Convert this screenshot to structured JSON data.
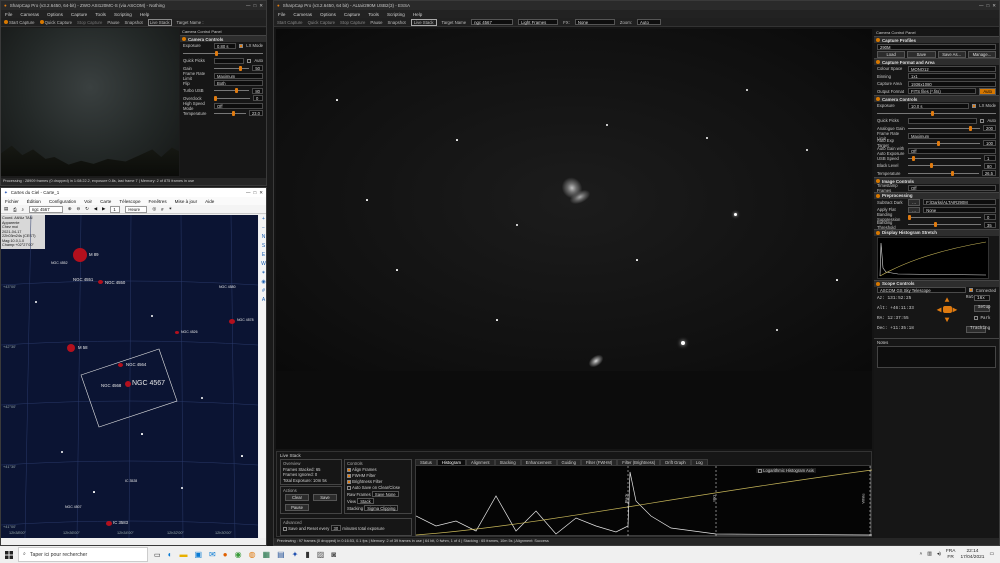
{
  "colors": {
    "accent": "#e07b10",
    "sky_bg": "#0b1433",
    "galaxy_marker": "#b3101d"
  },
  "small_sharpcap": {
    "title": "SharpCap Pro (v3.2.6450, 64-bit) - ZWO ASI120MC-S (via ASCOM) - Nothing",
    "menu": [
      "File",
      "Cameras",
      "Options",
      "Capture",
      "Tools",
      "Scripting",
      "Help"
    ],
    "toolbar": {
      "start": "Start Capture",
      "quick": "Quick Capture",
      "stop": "Stop Capture",
      "pause": "Pause",
      "snapshot": "Snapshot",
      "live_stack": "Live Stack",
      "target_label": "Target Name :"
    },
    "status": "Processing : 28909 frames (0 dropped) in 1:08:22.2, exposure 0.8s, last frame 7 | Memory: 2 of 875 frames in use",
    "controls": {
      "header": "Camera Controls",
      "panel_title": "Camera Control Panel",
      "exposure_label": "Exposure",
      "exposure_value": "0.80 s",
      "lx_mode": "LX Mode",
      "quick_picks": "Quick Picks",
      "auto": "Auto",
      "gain_label": "Gain",
      "gain_value": "50",
      "frame_rate_label": "Frame Rate Limit",
      "frame_rate_value": "Maximum",
      "flip_label": "Flip",
      "flip_value": "Both",
      "turbo_label": "Turbo USB",
      "turbo_value": "80",
      "overclock_label": "Overclock",
      "overclock_value": "0",
      "highspeed_label": "High Speed Mode",
      "highspeed_value": "Off",
      "temp_label": "Temperature",
      "temp_value": "23.0"
    }
  },
  "cdc": {
    "title": "Cartes du Ciel - Carte_1",
    "menu": [
      "Fichier",
      "Édition",
      "Configuration",
      "Voir",
      "Carte",
      "Télescope",
      "Fenêtres",
      "Mise à jour",
      "Aide"
    ],
    "search": "ngc 4567",
    "zoom_value": "1",
    "zoom_unit": "Heure",
    "info": [
      "Coord. Alt/Az TAN",
      "Apparente",
      "Chez moi",
      "2021-04-17",
      "22h03m24s (CEST)",
      "Mag:10.0,1.0",
      "Champ:+02°27'00\""
    ],
    "objects": [
      {
        "name": "M 89",
        "size": 14
      },
      {
        "name": "M 58",
        "size": 8
      },
      {
        "name": "NGC 4567",
        "size": 6
      },
      {
        "name": "NGC 4568",
        "size": 0
      },
      {
        "name": "NGC 4564",
        "size": 5
      },
      {
        "name": "NGC 4550",
        "size": 5
      },
      {
        "name": "NGC 4551",
        "size": 0
      },
      {
        "name": "NGC 4552",
        "size": 0
      },
      {
        "name": "NGC 4526",
        "size": 4
      },
      {
        "name": "NGC 4578",
        "size": 6
      },
      {
        "name": "NGC 4580",
        "size": 0
      },
      {
        "name": "IC 3528",
        "size": 0
      },
      {
        "name": "IC 3583",
        "size": 0
      },
      {
        "name": "NGC 4507",
        "size": 0
      }
    ],
    "dec_ticks": [
      "+43°00'",
      "+42°30'",
      "+42°00'",
      "+41°30'",
      "+41°00'"
    ],
    "ra_ticks": [
      "12h38'00\"",
      "12h36'00\"",
      "12h34'00\"",
      "12h32'00\"",
      "12h30'00\""
    ]
  },
  "main": {
    "title": "SharpCap Pro (v3.2.6450, 64 bit) - ALtair290M USB2(3) - ESSA",
    "menu": [
      "File",
      "Cameras",
      "Options",
      "Capture",
      "Tools",
      "Scripting",
      "Help"
    ],
    "toolbar": {
      "start": "Start Capture",
      "quick": "Quick Capture",
      "stop": "Stop Capture",
      "pause": "Pause",
      "snapshot": "Snapshot",
      "live_stack": "Live Stack",
      "target_label": "Target Name",
      "target_value": "ngc 4567",
      "frame_type": "Light Frames",
      "fx_label": "FX:",
      "fx_value": "None",
      "zoom_label": "Zoom:",
      "zoom_value": "Auto"
    },
    "right_panel": {
      "title": "Camera Control Panel",
      "capture_profiles": "Capture Profiles",
      "profile_value": "290M",
      "btn_load": "Load",
      "btn_save": "Save",
      "btn_saveas": "Save As...",
      "btn_manage": "Manage...",
      "format_header": "Capture Format and Area",
      "colour_space": "Colour Space",
      "colour_value": "MONO12",
      "binning": "Binning",
      "binning_value": "1x1",
      "area": "Capture Area",
      "area_value": "1936x1080",
      "output": "Output Format",
      "output_value": "FITS files (*.fits)",
      "output_auto": "Auto",
      "cam_header": "Camera Controls",
      "exposure": "Exposure",
      "exposure_value": "10.0 s",
      "lx": "LX Mode",
      "quick": "Quick Picks",
      "auto": "Auto",
      "analogue_gain": "Analogue Gain",
      "analogue_value": "200",
      "frame_rate": "Frame Rate Limit",
      "frame_rate_value": "Maximum",
      "auto_exp": "Auto Exp Target",
      "auto_exp_value": "100",
      "auto_gain": "Auto Gain with Auto Exposure",
      "auto_gain_value": "Off",
      "usb_speed": "USB Speed",
      "usb_value": "1",
      "black": "Black Level",
      "black_value": "80",
      "temperature": "Temperature",
      "temperature_value": "26.5",
      "image_header": "Image Controls",
      "timestamp": "Timestamp Frames",
      "timestamp_value": "Off",
      "pre_header": "Preprocessing",
      "subtract": "Subtract Dark",
      "subtract_value": "F:\\Darks\\ALTAIR290M",
      "flat": "Apply Flat",
      "flat_value": "None",
      "banding": "Banding Suppression",
      "banding_value": "0",
      "banding_thr": "Banding Threshold",
      "banding_thr_value": "35",
      "histogram": "Display Histogram Stretch",
      "scope": "Scope Controls",
      "scope_name": "ASCOM GS Sky Telescope",
      "connected": "Connected",
      "ra_l": "Az:",
      "ra_v": "131:52:25",
      "alt_l": "Alt:",
      "alt_v": "+46:11:33",
      "ra2_l": "RA:",
      "ra2_v": "12:37:55",
      "dec_l": "Dec:",
      "dec_v": "+11:35:18",
      "rate": "Rate",
      "rate_value": "16x",
      "setup": "Setup",
      "park": "Park",
      "tracking": "Tracking",
      "notes": "Notes"
    },
    "live_stack": {
      "title": "Live Stack",
      "overview": "Overview",
      "stacked_label": "Frames Stacked:",
      "stacked_value": "65",
      "ignored_label": "Frames Ignored:",
      "ignored_value": "0",
      "total_label": "Total Exposure:",
      "total_value": "10m 5s",
      "actions": "Actions",
      "btn_clear": "Clear",
      "btn_save": "Save",
      "btn_pause": "Pause",
      "controls": "Controls",
      "align": "Align Frames",
      "fwhm": "FWHM Filter",
      "brightness": "Brightness Filter",
      "autosave": "Auto Save on Clear/Close",
      "raw_label": "Raw Frames",
      "raw_value": "Save None",
      "view_label": "View",
      "view_value": "Stack",
      "stacking_label": "Stacking",
      "stacking_value": "Sigma Clipping",
      "advanced": "Advanced",
      "save_reset": "Save and Reset every",
      "save_reset_value": "30",
      "minutes": "minutes total exposure",
      "tabs": [
        "Status",
        "Histogram",
        "Alignment",
        "Stacking",
        "Enhancement",
        "Guiding",
        "Filter (FWHM)",
        "Filter (Brightness)",
        "Drift Graph",
        "Log"
      ],
      "logarithmic": "Logarithmic Histogram Axis",
      "black_label": "Black",
      "mid_label": "Mid",
      "white_label": "White"
    },
    "status": "Previewing : 97 frames (0 dropped) in 0:16:53, 0.1 fps | Memory: 2 of 39 frames in use | 64 bit, 0 fwhm, 1 of 4 | Stacking : 65 frames, 10m 5s | Alignment: Success"
  },
  "taskbar": {
    "search": "Taper ici pour rechercher",
    "lang": "FRA",
    "lang2": "FR",
    "time": "22:14",
    "date": "17/04/2021"
  }
}
